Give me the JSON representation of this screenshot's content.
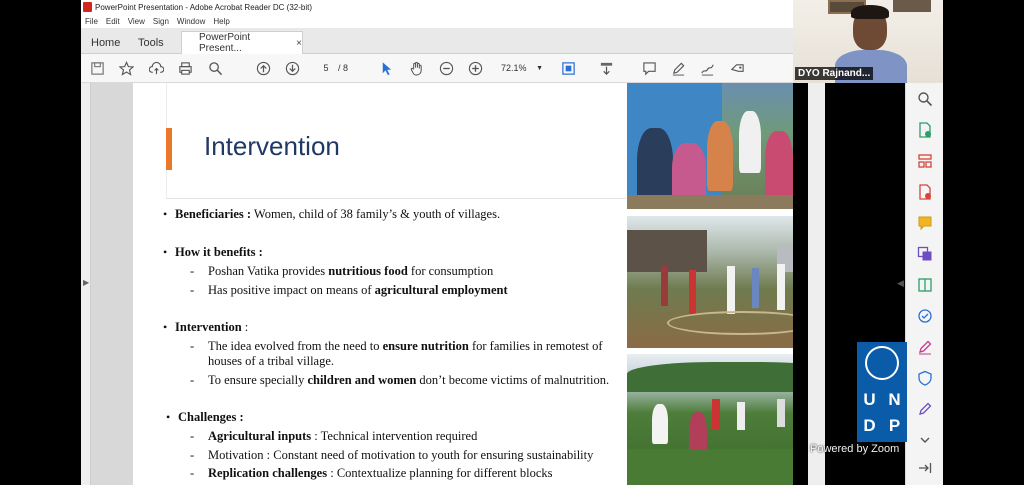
{
  "window": {
    "title": "PowerPoint Presentation - Adobe Acrobat Reader DC (32-bit)",
    "menu": [
      "File",
      "Edit",
      "View",
      "Sign",
      "Window",
      "Help"
    ]
  },
  "tabs": {
    "home": "Home",
    "tools": "Tools",
    "doc": "PowerPoint Present...",
    "close_glyph": "×"
  },
  "toolbar": {
    "page_current": "5",
    "page_total": "/ 8",
    "zoom": "72.1%",
    "icons": [
      "save-icon",
      "star-icon",
      "upload-icon",
      "print-icon",
      "search-icon",
      "page-up-icon",
      "page-down-icon",
      "select-pointer-icon",
      "hand-icon",
      "zoom-out-icon",
      "zoom-in-icon",
      "fit-page-icon",
      "scroll-mode-icon",
      "comment-icon",
      "highlight-pen-icon",
      "sign-icon",
      "share-icon"
    ]
  },
  "slide": {
    "title": "Intervention",
    "beneficiaries": {
      "label": "Beneficiaries :",
      "text": " Women, child of 38 family’s & youth of villages."
    },
    "benefits": {
      "label": "How it benefits :",
      "items": [
        {
          "pre": "Poshan Vatika provides ",
          "bold": "nutritious food",
          "post": " for consumption"
        },
        {
          "pre": "Has positive impact on means of ",
          "bold": "agricultural employment",
          "post": ""
        }
      ]
    },
    "intervention": {
      "label": "Intervention",
      "colon": " :",
      "items": [
        {
          "pre": "The idea evolved from the need to ",
          "bold": "ensure nutrition",
          "post": " for families in remotest of",
          "line2": "houses of a tribal village."
        },
        {
          "pre": "To ensure specially ",
          "bold": "children and women",
          "post": " don’t become victims of malnutrition."
        }
      ]
    },
    "challenges": {
      "label": "Challenges :",
      "items": [
        {
          "bold": "Agricultural inputs",
          "post": " : Technical intervention required"
        },
        {
          "bold": "",
          "post": "Motivation : Constant need of motivation to youth for ensuring sustainability"
        },
        {
          "bold": "Replication challenges",
          "post": " : Contextualize planning for different blocks"
        }
      ]
    },
    "bullet_glyph": "•",
    "dash_glyph": "-"
  },
  "zoom": {
    "participant": "DYO Rajnand...",
    "undp_letters": [
      "U",
      "N",
      "D",
      "P"
    ],
    "watermark": "Powered by Zoom"
  },
  "colors": {
    "accent": "#e9782a",
    "title": "#1f3864",
    "undp": "#0a5ca8"
  }
}
